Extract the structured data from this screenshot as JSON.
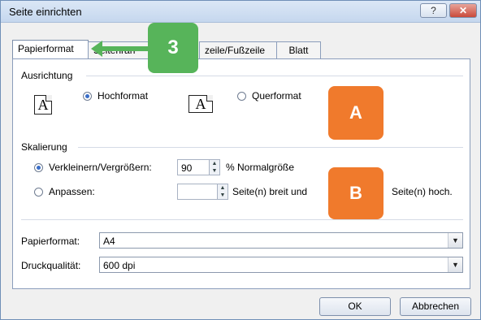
{
  "window": {
    "title": "Seite einrichten",
    "help_label": "?",
    "close_label": "✕"
  },
  "tabs": [
    {
      "label": "Papierformat"
    },
    {
      "label": "Seitenrän"
    },
    {
      "label": "zeile/Fußzeile"
    },
    {
      "label": "Blatt"
    }
  ],
  "orientation": {
    "section_label": "Ausrichtung",
    "portrait_label": "Hochformat",
    "landscape_label": "Querformat",
    "selected": "portrait",
    "icon_glyph": "A"
  },
  "scaling": {
    "section_label": "Skalierung",
    "reduce_label": "Verkleinern/Vergrößern:",
    "reduce_value": "90",
    "reduce_unit": "% Normalgröße",
    "fit_label": "Anpassen:",
    "fit_wide_text": "Seite(n) breit und",
    "fit_tall_text": "Seite(n) hoch.",
    "selected": "reduce"
  },
  "paper": {
    "label": "Papierformat:",
    "value": "A4"
  },
  "quality": {
    "label": "Druckqualität:",
    "value": "600 dpi"
  },
  "buttons": {
    "ok": "OK",
    "cancel": "Abbrechen"
  },
  "annotations": {
    "step": "3",
    "a": "A",
    "b": "B"
  },
  "colors": {
    "accent_green": "#57b45a",
    "accent_orange": "#f07a2c",
    "radio_dot": "#3a6ec8"
  }
}
